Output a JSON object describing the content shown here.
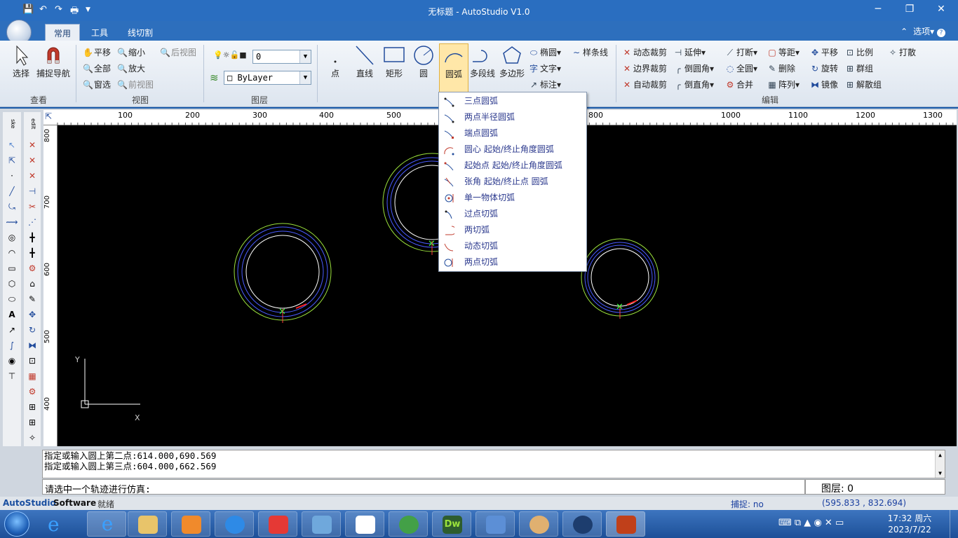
{
  "window": {
    "title": "无标题 - AutoStudio V1.0"
  },
  "tabs": [
    "常用",
    "工具",
    "线切割"
  ],
  "options_label": "选项",
  "ribbon": {
    "view": {
      "select": "选择",
      "snap": "捕捉导航",
      "pan": "平移",
      "zoom_out": "缩小",
      "all": "全部",
      "zoom_in": "放大",
      "window_sel": "窗选",
      "prev_view": "前视图",
      "next_view": "后视图",
      "group_check": "查看",
      "group_view": "视图"
    },
    "layer": {
      "name": "0",
      "linetype": "ByLayer",
      "group": "图层"
    },
    "draw": {
      "point": "点",
      "line": "直线",
      "rect": "矩形",
      "circle": "圆",
      "arc": "圆弧",
      "polyline": "多段线",
      "polygon": "多边形",
      "ellipse": "椭圆",
      "spline": "样条线",
      "text": "文字",
      "dim": "标注"
    },
    "edit": {
      "dyn_trim": "动态裁剪",
      "extend": "延伸",
      "break": "打断",
      "offset": "等距",
      "move": "平移",
      "scale": "比例",
      "explode": "打散",
      "bound_trim": "边界裁剪",
      "fillet": "倒圆角",
      "all_round": "全圆",
      "delete": "删除",
      "rotate": "旋转",
      "group": "群组",
      "auto_trim": "自动裁剪",
      "chamfer": "倒直角",
      "join": "合并",
      "array": "阵列",
      "mirror": "镜像",
      "ungroup": "解散组",
      "group_label": "编辑"
    }
  },
  "arc_menu": [
    "三点圆弧",
    "两点半径圆弧",
    "端点圆弧",
    "圆心 起始/终止角度圆弧",
    "起始点 起始/终止角度圆弧",
    "张角 起始/终止点 圆弧",
    "单一物体切弧",
    "过点切弧",
    "两切弧",
    "动态切弧",
    "两点切弧"
  ],
  "ruler_h": [
    "100",
    "200",
    "300",
    "400",
    "500",
    "800",
    "1000",
    "1100",
    "1200",
    "1300"
  ],
  "ruler_v": [
    "800",
    "700",
    "600",
    "500",
    "400"
  ],
  "axis": {
    "y": "Y",
    "x": "X"
  },
  "command": {
    "line1": "指定或输入圆上第二点:614.000,690.569",
    "line2": "指定或输入圆上第三点:604.000,662.569",
    "prompt": "请选中一个轨迹进行仿真:"
  },
  "layer_status": "图层: 0",
  "status": {
    "brand": "AutoStudio",
    "brand2": "Software",
    "ready": "就绪",
    "snap": "捕捉: no",
    "coords": "(595.833 , 832.694)"
  },
  "clock": {
    "time": "17:32 周六",
    "date": "2023/7/22"
  },
  "left_tabs": [
    "ske",
    "edit"
  ]
}
